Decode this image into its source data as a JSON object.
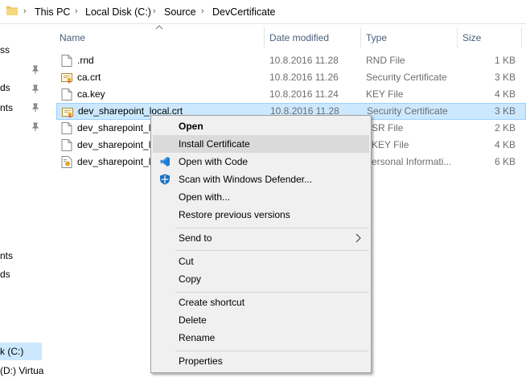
{
  "breadcrumb": {
    "items": [
      "This PC",
      "Local Disk (C:)",
      "Source",
      "DevCertificate"
    ],
    "separator": "›"
  },
  "nav": {
    "items": [
      "ss",
      "ds",
      "nts",
      "nts",
      "ds",
      "k (C:)",
      "(D:) Virtua"
    ]
  },
  "columns": {
    "name": "Name",
    "date": "Date modified",
    "type": "Type",
    "size": "Size"
  },
  "files": [
    {
      "name": ".rnd",
      "date": "10.8.2016 11.28",
      "type": "RND File",
      "size": "1 KB",
      "icon": "generic-file-icon"
    },
    {
      "name": "ca.crt",
      "date": "10.8.2016 11.26",
      "type": "Security Certificate",
      "size": "3 KB",
      "icon": "certificate-icon"
    },
    {
      "name": "ca.key",
      "date": "10.8.2016 11.24",
      "type": "KEY File",
      "size": "4 KB",
      "icon": "generic-file-icon"
    },
    {
      "name": "dev_sharepoint_local.crt",
      "date": "10.8.2016 11.28",
      "type": "Security Certificate",
      "size": "3 KB",
      "icon": "certificate-icon"
    },
    {
      "name": "dev_sharepoint_lo",
      "date": "",
      "type": "SR File",
      "size": "2 KB",
      "icon": "generic-file-icon"
    },
    {
      "name": "dev_sharepoint_lo",
      "date": "",
      "type": "KEY File",
      "size": "4 KB",
      "icon": "generic-file-icon"
    },
    {
      "name": "dev_sharepoint_lo",
      "date": "",
      "type": "ersonal Informati...",
      "size": "6 KB",
      "icon": "personal-info-icon"
    }
  ],
  "context_menu": {
    "open": "Open",
    "install_certificate": "Install Certificate",
    "open_with_code": "Open with Code",
    "scan_defender": "Scan with Windows Defender...",
    "open_with": "Open with...",
    "restore_versions": "Restore previous versions",
    "send_to": "Send to",
    "cut": "Cut",
    "copy": "Copy",
    "create_shortcut": "Create shortcut",
    "delete": "Delete",
    "rename": "Rename",
    "properties": "Properties"
  },
  "colors": {
    "selection_bg": "#cce8ff",
    "selection_border": "#99d1ff",
    "menu_bg": "#f0f0f0",
    "menu_hover": "#dadada",
    "header_text": "#4c607a",
    "muted_text": "#6d6d6d"
  }
}
